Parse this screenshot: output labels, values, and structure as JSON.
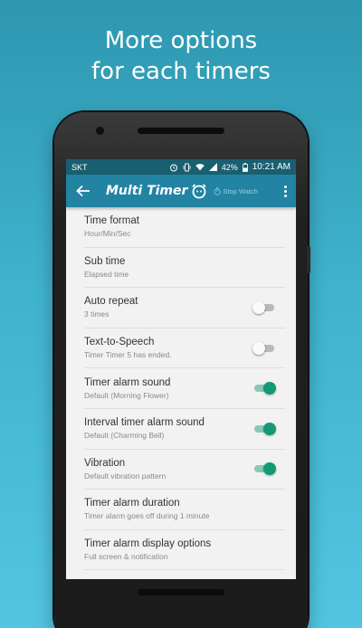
{
  "promo": {
    "line1": "More options",
    "line2": "for each timers"
  },
  "statusbar": {
    "carrier": "SKT",
    "battery": "42%",
    "time": "10:21 AM",
    "icons": [
      "alarm-icon",
      "vibrate-icon",
      "wifi-icon",
      "signal-icon",
      "battery-icon"
    ]
  },
  "appbar": {
    "title": "Multi Timer",
    "stopwatch_tab": "Stop Watch",
    "color": "#2283a3"
  },
  "settings": [
    {
      "title": "Time format",
      "subtitle": "Hour/Min/Sec",
      "toggle": null
    },
    {
      "title": "Sub time",
      "subtitle": "Elapsed time",
      "toggle": null
    },
    {
      "title": "Auto repeat",
      "subtitle": "3 times",
      "toggle": false
    },
    {
      "title": "Text-to-Speech",
      "subtitle": "Timer Timer 5 has ended.",
      "toggle": false
    },
    {
      "title": "Timer alarm sound",
      "subtitle": "Default (Morning Flower)",
      "toggle": true
    },
    {
      "title": "Interval timer alarm sound",
      "subtitle": "Default (Charming Bell)",
      "toggle": true
    },
    {
      "title": "Vibration",
      "subtitle": "Default vibration pattern",
      "toggle": true
    },
    {
      "title": "Timer alarm duration",
      "subtitle": "Timer alarm goes off during 1 minute",
      "toggle": null
    },
    {
      "title": "Timer alarm display options",
      "subtitle": "Full screen & notification",
      "toggle": null
    }
  ],
  "colors": {
    "toggle_on": "#119a75",
    "statusbar": "#195f70"
  }
}
